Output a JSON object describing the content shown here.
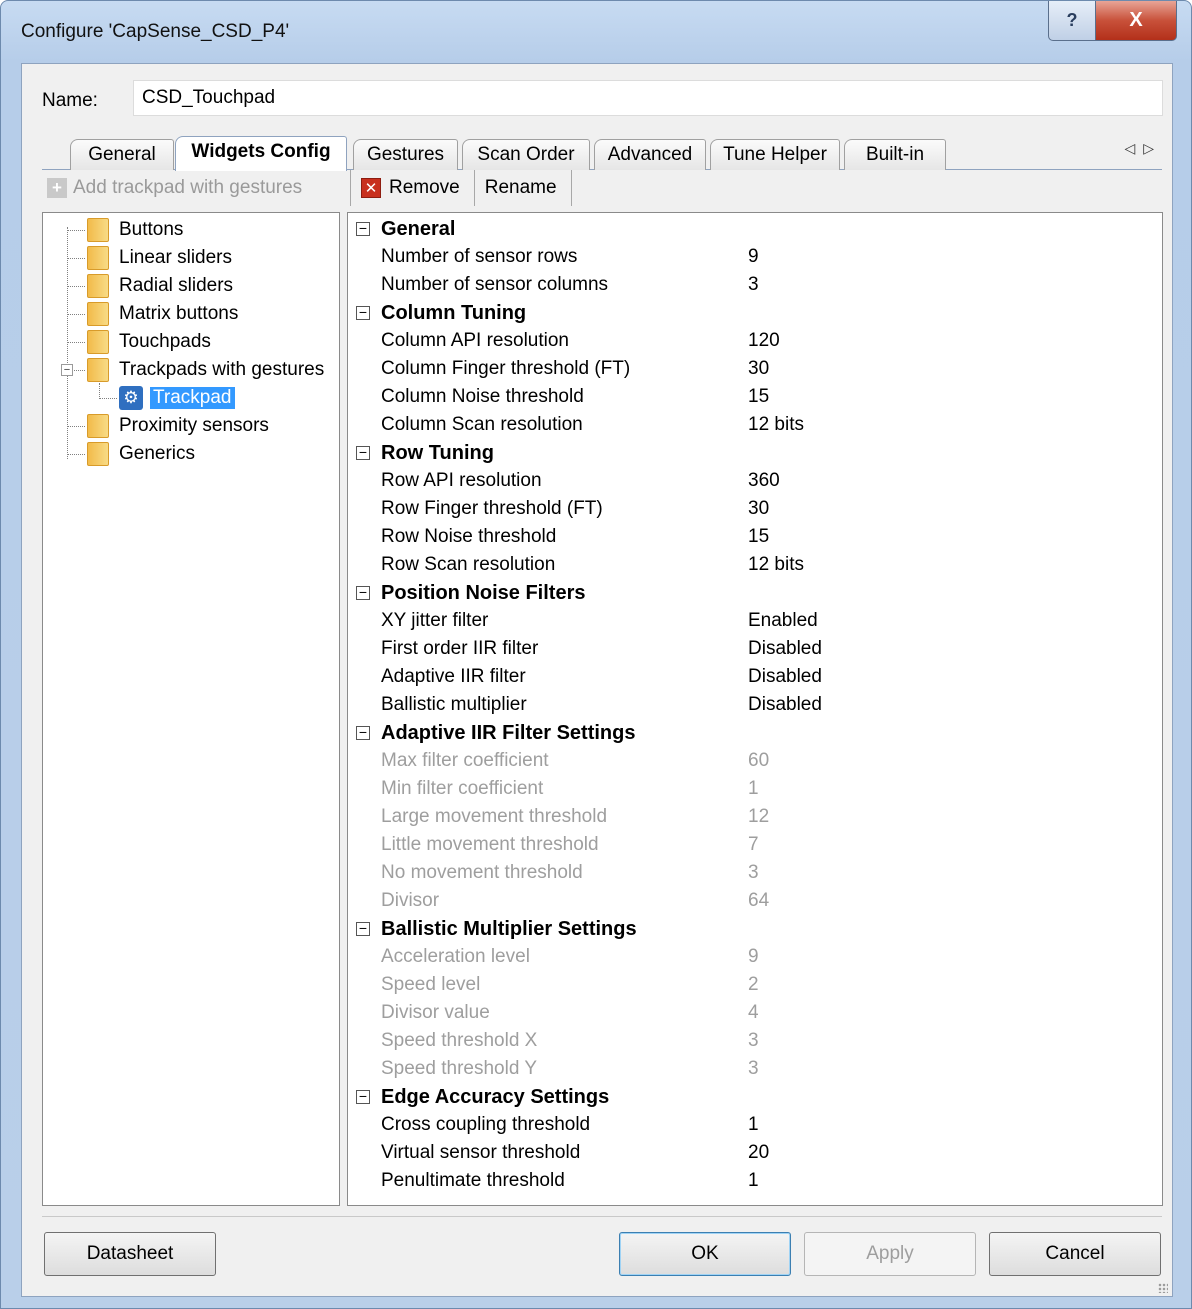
{
  "window": {
    "title": "Configure 'CapSense_CSD_P4'",
    "help_glyph": "?",
    "close_glyph": "X"
  },
  "name_field": {
    "label": "Name:",
    "value": "CSD_Touchpad"
  },
  "tabs": [
    {
      "label": "General",
      "active": false
    },
    {
      "label": "Widgets Config",
      "active": true
    },
    {
      "label": "Gestures",
      "active": false
    },
    {
      "label": "Scan Order",
      "active": false
    },
    {
      "label": "Advanced",
      "active": false
    },
    {
      "label": "Tune Helper",
      "active": false
    },
    {
      "label": "Built-in",
      "active": false
    }
  ],
  "tab_scroll_glyphs": "◁▷",
  "toolbar": {
    "add_label": "Add trackpad with gestures",
    "remove_label": "Remove",
    "rename_label": "Rename"
  },
  "tree": {
    "items": [
      "Buttons",
      "Linear sliders",
      "Radial sliders",
      "Matrix buttons",
      "Touchpads",
      "Trackpads with gestures",
      "Proximity sensors",
      "Generics"
    ],
    "child": "Trackpad"
  },
  "properties": {
    "sections": [
      {
        "title": "General",
        "rows": [
          {
            "name": "Number of sensor rows",
            "value": "9",
            "disabled": false
          },
          {
            "name": "Number of sensor columns",
            "value": "3",
            "disabled": false
          }
        ]
      },
      {
        "title": "Column Tuning",
        "rows": [
          {
            "name": "Column API resolution",
            "value": "120",
            "disabled": false
          },
          {
            "name": "Column Finger threshold (FT)",
            "value": "30",
            "disabled": false
          },
          {
            "name": "Column Noise threshold",
            "value": "15",
            "disabled": false
          },
          {
            "name": "Column Scan resolution",
            "value": "12 bits",
            "disabled": false
          }
        ]
      },
      {
        "title": "Row Tuning",
        "rows": [
          {
            "name": "Row API resolution",
            "value": "360",
            "disabled": false
          },
          {
            "name": "Row Finger threshold (FT)",
            "value": "30",
            "disabled": false
          },
          {
            "name": "Row Noise threshold",
            "value": "15",
            "disabled": false
          },
          {
            "name": "Row Scan resolution",
            "value": "12 bits",
            "disabled": false
          }
        ]
      },
      {
        "title": "Position Noise Filters",
        "rows": [
          {
            "name": "XY jitter filter",
            "value": "Enabled",
            "disabled": false
          },
          {
            "name": "First order IIR filter",
            "value": "Disabled",
            "disabled": false
          },
          {
            "name": "Adaptive IIR filter",
            "value": "Disabled",
            "disabled": false
          },
          {
            "name": "Ballistic multiplier",
            "value": "Disabled",
            "disabled": false
          }
        ]
      },
      {
        "title": "Adaptive IIR Filter Settings",
        "rows": [
          {
            "name": "Max filter coefficient",
            "value": "60",
            "disabled": true
          },
          {
            "name": "Min filter coefficient",
            "value": "1",
            "disabled": true
          },
          {
            "name": "Large movement threshold",
            "value": "12",
            "disabled": true
          },
          {
            "name": "Little movement threshold",
            "value": "7",
            "disabled": true
          },
          {
            "name": "No movement threshold",
            "value": "3",
            "disabled": true
          },
          {
            "name": "Divisor",
            "value": "64",
            "disabled": true
          }
        ]
      },
      {
        "title": "Ballistic Multiplier Settings",
        "rows": [
          {
            "name": "Acceleration level",
            "value": "9",
            "disabled": true
          },
          {
            "name": "Speed level",
            "value": "2",
            "disabled": true
          },
          {
            "name": "Divisor value",
            "value": "4",
            "disabled": true
          },
          {
            "name": "Speed threshold X",
            "value": "3",
            "disabled": true
          },
          {
            "name": "Speed threshold Y",
            "value": "3",
            "disabled": true
          }
        ]
      },
      {
        "title": "Edge Accuracy Settings",
        "rows": [
          {
            "name": "Cross coupling threshold",
            "value": "1",
            "disabled": false
          },
          {
            "name": "Virtual sensor threshold",
            "value": "20",
            "disabled": false
          },
          {
            "name": "Penultimate threshold",
            "value": "1",
            "disabled": false
          }
        ]
      }
    ]
  },
  "buttons": {
    "datasheet": "Datasheet",
    "ok": "OK",
    "apply": "Apply",
    "cancel": "Cancel"
  }
}
